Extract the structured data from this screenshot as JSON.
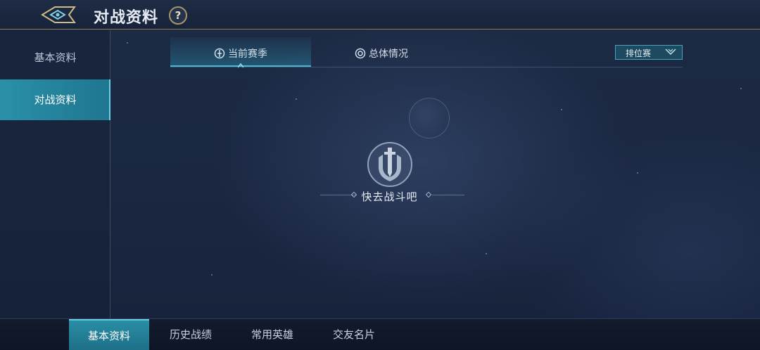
{
  "header": {
    "title": "对战资料",
    "help_label": "?"
  },
  "sidebar": {
    "items": [
      {
        "label": "基本资料",
        "active": false
      },
      {
        "label": "对战资料",
        "active": true
      }
    ]
  },
  "tabs": [
    {
      "label": "当前赛季",
      "icon": "season-icon",
      "active": true
    },
    {
      "label": "总体情况",
      "icon": "overview-icon",
      "active": false
    }
  ],
  "mode_select": {
    "selected": "排位赛",
    "icon": "chevron-down-icon"
  },
  "empty_state": {
    "icon": "sword-shield-icon",
    "message": "快去战斗吧"
  },
  "bottom_nav": {
    "items": [
      {
        "label": "基本资料",
        "active": true
      },
      {
        "label": "历史战绩",
        "active": false
      },
      {
        "label": "常用英雄",
        "active": false
      },
      {
        "label": "交友名片",
        "active": false
      }
    ]
  },
  "colors": {
    "accent": "#2a90a8",
    "accent_light": "#4fb6cf",
    "gold_trim": "#a89766",
    "background": "#1a2740"
  }
}
